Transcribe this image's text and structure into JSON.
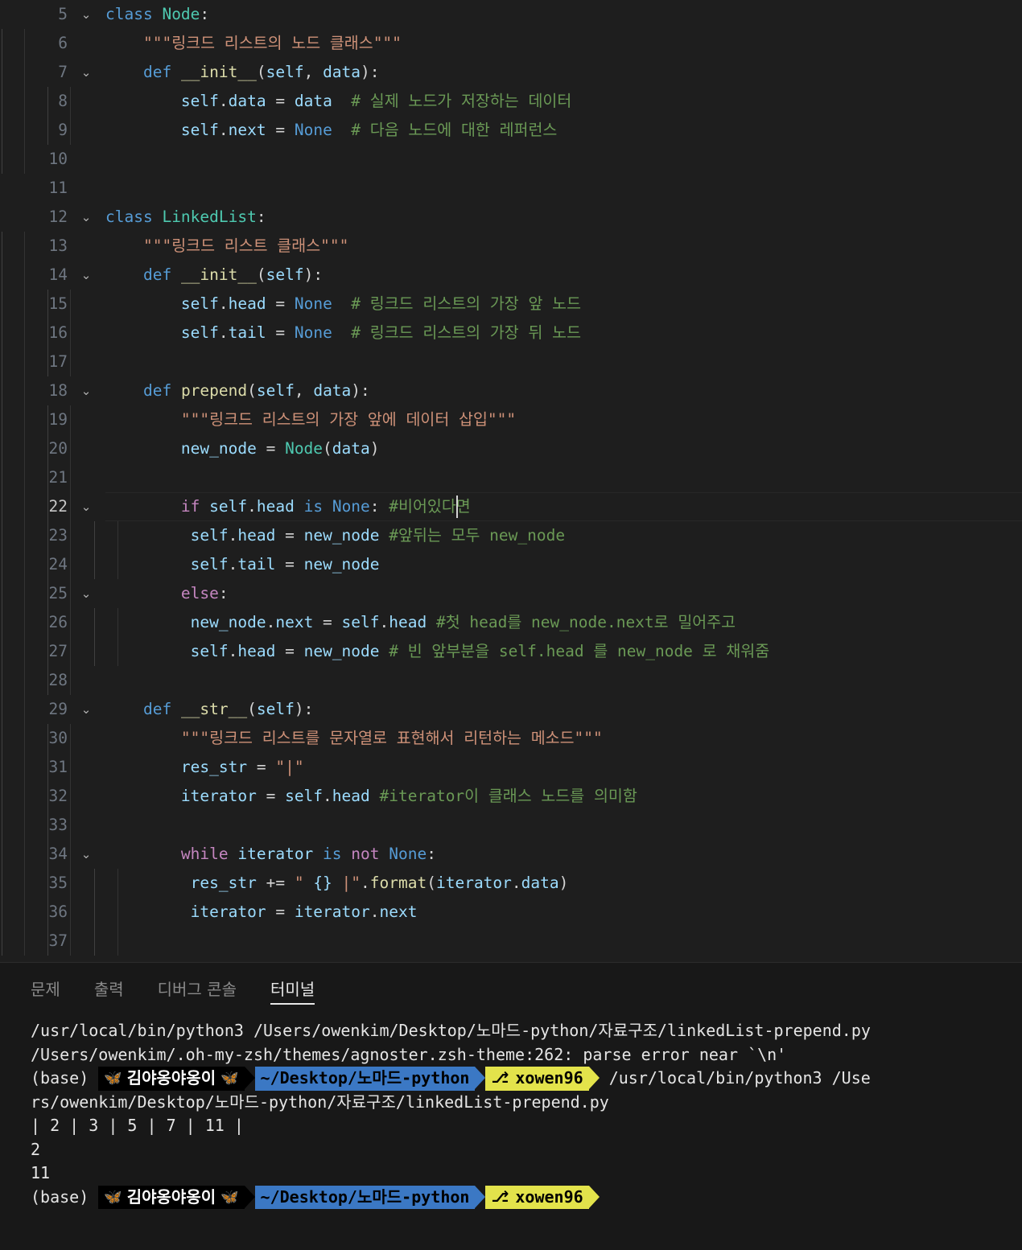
{
  "editor": {
    "language": "python",
    "active_line": 22,
    "colors": {
      "background": "#1e1e1e",
      "keyword_control": "#c586c0",
      "keyword": "#569cd6",
      "class_name": "#4ec9b0",
      "function": "#dcdcaa",
      "variable": "#9cdcfe",
      "string": "#ce9178",
      "comment": "#6a9955",
      "line_number": "#6e7681",
      "active_line_number": "#c6c6c6"
    },
    "lines": [
      {
        "n": "5",
        "fold": "chevron-down",
        "guides": 0,
        "active": false,
        "tokens": [
          {
            "t": "class ",
            "c": "kw2"
          },
          {
            "t": "Node",
            "c": "cls"
          },
          {
            "t": ":",
            "c": "pl"
          }
        ]
      },
      {
        "n": "6",
        "fold": "",
        "guides": 1,
        "active": false,
        "indent": 1,
        "tokens": [
          {
            "t": "\"\"\"링크드 리스트의 노드 클래스\"\"\"",
            "c": "str"
          }
        ]
      },
      {
        "n": "7",
        "fold": "chevron-down",
        "guides": 1,
        "active": false,
        "indent": 1,
        "tokens": [
          {
            "t": "def ",
            "c": "kw2"
          },
          {
            "t": "__init__",
            "c": "fn"
          },
          {
            "t": "(",
            "c": "pl"
          },
          {
            "t": "self",
            "c": "var"
          },
          {
            "t": ", ",
            "c": "pl"
          },
          {
            "t": "data",
            "c": "var"
          },
          {
            "t": "):",
            "c": "pl"
          }
        ]
      },
      {
        "n": "8",
        "fold": "",
        "guides": 2,
        "active": false,
        "indent": 2,
        "tokens": [
          {
            "t": "self",
            "c": "var"
          },
          {
            "t": ".",
            "c": "pl"
          },
          {
            "t": "data",
            "c": "var"
          },
          {
            "t": " = ",
            "c": "pl"
          },
          {
            "t": "data",
            "c": "var"
          },
          {
            "t": "  ",
            "c": "pl"
          },
          {
            "t": "# 실제 노드가 저장하는 데이터",
            "c": "cmt"
          }
        ]
      },
      {
        "n": "9",
        "fold": "",
        "guides": 2,
        "active": false,
        "indent": 2,
        "tokens": [
          {
            "t": "self",
            "c": "var"
          },
          {
            "t": ".",
            "c": "pl"
          },
          {
            "t": "next",
            "c": "var"
          },
          {
            "t": " = ",
            "c": "pl"
          },
          {
            "t": "None",
            "c": "kw2"
          },
          {
            "t": "  ",
            "c": "pl"
          },
          {
            "t": "# 다음 노드에 대한 레퍼런스",
            "c": "cmt"
          }
        ]
      },
      {
        "n": "10",
        "fold": "",
        "guides": 1,
        "active": false,
        "tokens": []
      },
      {
        "n": "11",
        "fold": "",
        "guides": 0,
        "active": false,
        "tokens": []
      },
      {
        "n": "12",
        "fold": "chevron-down",
        "guides": 0,
        "active": false,
        "tokens": [
          {
            "t": "class ",
            "c": "kw2"
          },
          {
            "t": "LinkedList",
            "c": "cls"
          },
          {
            "t": ":",
            "c": "pl"
          }
        ]
      },
      {
        "n": "13",
        "fold": "",
        "guides": 1,
        "active": false,
        "indent": 1,
        "tokens": [
          {
            "t": "\"\"\"링크드 리스트 클래스\"\"\"",
            "c": "str"
          }
        ]
      },
      {
        "n": "14",
        "fold": "chevron-down",
        "guides": 1,
        "active": false,
        "indent": 1,
        "tokens": [
          {
            "t": "def ",
            "c": "kw2"
          },
          {
            "t": "__init__",
            "c": "fn"
          },
          {
            "t": "(",
            "c": "pl"
          },
          {
            "t": "self",
            "c": "var"
          },
          {
            "t": "):",
            "c": "pl"
          }
        ]
      },
      {
        "n": "15",
        "fold": "",
        "guides": 2,
        "active": false,
        "indent": 2,
        "tokens": [
          {
            "t": "self",
            "c": "var"
          },
          {
            "t": ".",
            "c": "pl"
          },
          {
            "t": "head",
            "c": "var"
          },
          {
            "t": " = ",
            "c": "pl"
          },
          {
            "t": "None",
            "c": "kw2"
          },
          {
            "t": "  ",
            "c": "pl"
          },
          {
            "t": "# 링크드 리스트의 가장 앞 노드",
            "c": "cmt"
          }
        ]
      },
      {
        "n": "16",
        "fold": "",
        "guides": 2,
        "active": false,
        "indent": 2,
        "tokens": [
          {
            "t": "self",
            "c": "var"
          },
          {
            "t": ".",
            "c": "pl"
          },
          {
            "t": "tail",
            "c": "var"
          },
          {
            "t": " = ",
            "c": "pl"
          },
          {
            "t": "None",
            "c": "kw2"
          },
          {
            "t": "  ",
            "c": "pl"
          },
          {
            "t": "# 링크드 리스트의 가장 뒤 노드",
            "c": "cmt"
          }
        ]
      },
      {
        "n": "17",
        "fold": "",
        "guides": 2,
        "active": false,
        "tokens": []
      },
      {
        "n": "18",
        "fold": "chevron-down",
        "guides": 1,
        "active": false,
        "indent": 1,
        "tokens": [
          {
            "t": "def ",
            "c": "kw2"
          },
          {
            "t": "prepend",
            "c": "fn"
          },
          {
            "t": "(",
            "c": "pl"
          },
          {
            "t": "self",
            "c": "var"
          },
          {
            "t": ", ",
            "c": "pl"
          },
          {
            "t": "data",
            "c": "var"
          },
          {
            "t": "):",
            "c": "pl"
          }
        ]
      },
      {
        "n": "19",
        "fold": "",
        "guides": 2,
        "active": false,
        "indent": 2,
        "tokens": [
          {
            "t": "\"\"\"링크드 리스트의 가장 앞에 데이터 삽입\"\"\"",
            "c": "str"
          }
        ]
      },
      {
        "n": "20",
        "fold": "",
        "guides": 2,
        "active": false,
        "indent": 2,
        "tokens": [
          {
            "t": "new_node",
            "c": "var"
          },
          {
            "t": " = ",
            "c": "pl"
          },
          {
            "t": "Node",
            "c": "cls"
          },
          {
            "t": "(",
            "c": "pl"
          },
          {
            "t": "data",
            "c": "var"
          },
          {
            "t": ")",
            "c": "pl"
          }
        ]
      },
      {
        "n": "21",
        "fold": "",
        "guides": 2,
        "active": false,
        "tokens": []
      },
      {
        "n": "22",
        "fold": "chevron-down",
        "guides": 2,
        "active": true,
        "indent": 2,
        "tokens": [
          {
            "t": "if ",
            "c": "kw"
          },
          {
            "t": "self",
            "c": "var"
          },
          {
            "t": ".",
            "c": "pl"
          },
          {
            "t": "head",
            "c": "var"
          },
          {
            "t": " ",
            "c": "pl"
          },
          {
            "t": "is ",
            "c": "kw2"
          },
          {
            "t": "None",
            "c": "kw2"
          },
          {
            "t": ": ",
            "c": "pl"
          },
          {
            "t": "#비어있다면 ",
            "c": "cmt"
          }
        ],
        "cursor": true
      },
      {
        "n": "23",
        "fold": "",
        "guides": 3,
        "active": false,
        "indent": 3,
        "half": true,
        "tokens": [
          {
            "t": "self",
            "c": "var"
          },
          {
            "t": ".",
            "c": "pl"
          },
          {
            "t": "head",
            "c": "var"
          },
          {
            "t": " = ",
            "c": "pl"
          },
          {
            "t": "new_node",
            "c": "var"
          },
          {
            "t": " ",
            "c": "pl"
          },
          {
            "t": "#앞뒤는 모두 new_node",
            "c": "cmt"
          }
        ]
      },
      {
        "n": "24",
        "fold": "",
        "guides": 3,
        "active": false,
        "indent": 3,
        "half": true,
        "tokens": [
          {
            "t": "self",
            "c": "var"
          },
          {
            "t": ".",
            "c": "pl"
          },
          {
            "t": "tail",
            "c": "var"
          },
          {
            "t": " = ",
            "c": "pl"
          },
          {
            "t": "new_node",
            "c": "var"
          }
        ]
      },
      {
        "n": "25",
        "fold": "chevron-down",
        "guides": 2,
        "active": false,
        "indent": 2,
        "tokens": [
          {
            "t": "else",
            "c": "kw"
          },
          {
            "t": ":",
            "c": "pl"
          }
        ]
      },
      {
        "n": "26",
        "fold": "",
        "guides": 3,
        "active": false,
        "indent": 3,
        "half": true,
        "tokens": [
          {
            "t": "new_node",
            "c": "var"
          },
          {
            "t": ".",
            "c": "pl"
          },
          {
            "t": "next",
            "c": "var"
          },
          {
            "t": " = ",
            "c": "pl"
          },
          {
            "t": "self",
            "c": "var"
          },
          {
            "t": ".",
            "c": "pl"
          },
          {
            "t": "head",
            "c": "var"
          },
          {
            "t": " ",
            "c": "pl"
          },
          {
            "t": "#첫 head를 new_node.next로 밀어주고",
            "c": "cmt"
          }
        ]
      },
      {
        "n": "27",
        "fold": "",
        "guides": 3,
        "active": false,
        "indent": 3,
        "half": true,
        "tokens": [
          {
            "t": "self",
            "c": "var"
          },
          {
            "t": ".",
            "c": "pl"
          },
          {
            "t": "head",
            "c": "var"
          },
          {
            "t": " = ",
            "c": "pl"
          },
          {
            "t": "new_node",
            "c": "var"
          },
          {
            "t": " ",
            "c": "pl"
          },
          {
            "t": "# 빈 앞부분을 self.head 를 new_node 로 채워줌",
            "c": "cmt"
          }
        ]
      },
      {
        "n": "28",
        "fold": "",
        "guides": 2,
        "active": false,
        "tokens": []
      },
      {
        "n": "29",
        "fold": "chevron-down",
        "guides": 1,
        "active": false,
        "indent": 1,
        "tokens": [
          {
            "t": "def ",
            "c": "kw2"
          },
          {
            "t": "__str__",
            "c": "fn"
          },
          {
            "t": "(",
            "c": "pl"
          },
          {
            "t": "self",
            "c": "var"
          },
          {
            "t": "):",
            "c": "pl"
          }
        ]
      },
      {
        "n": "30",
        "fold": "",
        "guides": 2,
        "active": false,
        "indent": 2,
        "tokens": [
          {
            "t": "\"\"\"링크드 리스트를 문자열로 표현해서 리턴하는 메소드\"\"\"",
            "c": "str"
          }
        ]
      },
      {
        "n": "31",
        "fold": "",
        "guides": 2,
        "active": false,
        "indent": 2,
        "tokens": [
          {
            "t": "res_str",
            "c": "var"
          },
          {
            "t": " = ",
            "c": "pl"
          },
          {
            "t": "\"|\"",
            "c": "str"
          }
        ]
      },
      {
        "n": "32",
        "fold": "",
        "guides": 2,
        "active": false,
        "indent": 2,
        "tokens": [
          {
            "t": "iterator",
            "c": "var"
          },
          {
            "t": " = ",
            "c": "pl"
          },
          {
            "t": "self",
            "c": "var"
          },
          {
            "t": ".",
            "c": "pl"
          },
          {
            "t": "head",
            "c": "var"
          },
          {
            "t": " ",
            "c": "pl"
          },
          {
            "t": "#iterator이 클래스 노드를 의미함",
            "c": "cmt"
          }
        ]
      },
      {
        "n": "33",
        "fold": "",
        "guides": 2,
        "active": false,
        "tokens": []
      },
      {
        "n": "34",
        "fold": "chevron-down",
        "guides": 2,
        "active": false,
        "indent": 2,
        "tokens": [
          {
            "t": "while ",
            "c": "kw"
          },
          {
            "t": "iterator",
            "c": "var"
          },
          {
            "t": " ",
            "c": "pl"
          },
          {
            "t": "is ",
            "c": "kw2"
          },
          {
            "t": "not ",
            "c": "kw"
          },
          {
            "t": "None",
            "c": "kw2"
          },
          {
            "t": ":",
            "c": "pl"
          }
        ]
      },
      {
        "n": "35",
        "fold": "",
        "guides": 3,
        "active": false,
        "indent": 3,
        "half": true,
        "tokens": [
          {
            "t": "res_str",
            "c": "var"
          },
          {
            "t": " += ",
            "c": "pl"
          },
          {
            "t": "\" ",
            "c": "str"
          },
          {
            "t": "{}",
            "c": "brace"
          },
          {
            "t": " |\"",
            "c": "str"
          },
          {
            "t": ".",
            "c": "pl"
          },
          {
            "t": "format",
            "c": "fn"
          },
          {
            "t": "(",
            "c": "pl"
          },
          {
            "t": "iterator",
            "c": "var"
          },
          {
            "t": ".",
            "c": "pl"
          },
          {
            "t": "data",
            "c": "var"
          },
          {
            "t": ")",
            "c": "pl"
          }
        ]
      },
      {
        "n": "36",
        "fold": "",
        "guides": 3,
        "active": false,
        "indent": 3,
        "half": true,
        "tokens": [
          {
            "t": "iterator",
            "c": "var"
          },
          {
            "t": " = ",
            "c": "pl"
          },
          {
            "t": "iterator",
            "c": "var"
          },
          {
            "t": ".",
            "c": "pl"
          },
          {
            "t": "next",
            "c": "var"
          }
        ]
      },
      {
        "n": "37",
        "fold": "",
        "guides": 3,
        "active": false,
        "tokens": []
      }
    ]
  },
  "panel": {
    "tabs": [
      {
        "label": "문제",
        "active": false
      },
      {
        "label": "출력",
        "active": false
      },
      {
        "label": "디버그 콘솔",
        "active": false
      },
      {
        "label": "터미널",
        "active": true
      }
    ]
  },
  "terminal": {
    "prompt": {
      "base_label": "(base) ",
      "user_segment": "김야옹야옹이",
      "butterfly": "🦋",
      "path_segment": "~/Desktop/노마드-python",
      "git_segment": "xowen96",
      "git_glyph": "⎇",
      "colors": {
        "user_bg": "#000000",
        "path_bg": "#3b78c4",
        "git_bg": "#e3e34b",
        "butterfly": "#3ba7f0"
      }
    },
    "lines": [
      {
        "type": "text",
        "text": "/usr/local/bin/python3 /Users/owenkim/Desktop/노마드-python/자료구조/linkedList-prepend.py"
      },
      {
        "type": "text",
        "text": "/Users/owenkim/.oh-my-zsh/themes/agnoster.zsh-theme:262: parse error near `\\n'"
      },
      {
        "type": "prompt",
        "trailing": " /usr/local/bin/python3 /Use"
      },
      {
        "type": "text",
        "text": "rs/owenkim/Desktop/노마드-python/자료구조/linkedList-prepend.py"
      },
      {
        "type": "text",
        "text": "| 2 | 3 | 5 | 7 | 11 |"
      },
      {
        "type": "text",
        "text": "2"
      },
      {
        "type": "text",
        "text": "11"
      },
      {
        "type": "prompt",
        "trailing": ""
      }
    ]
  }
}
